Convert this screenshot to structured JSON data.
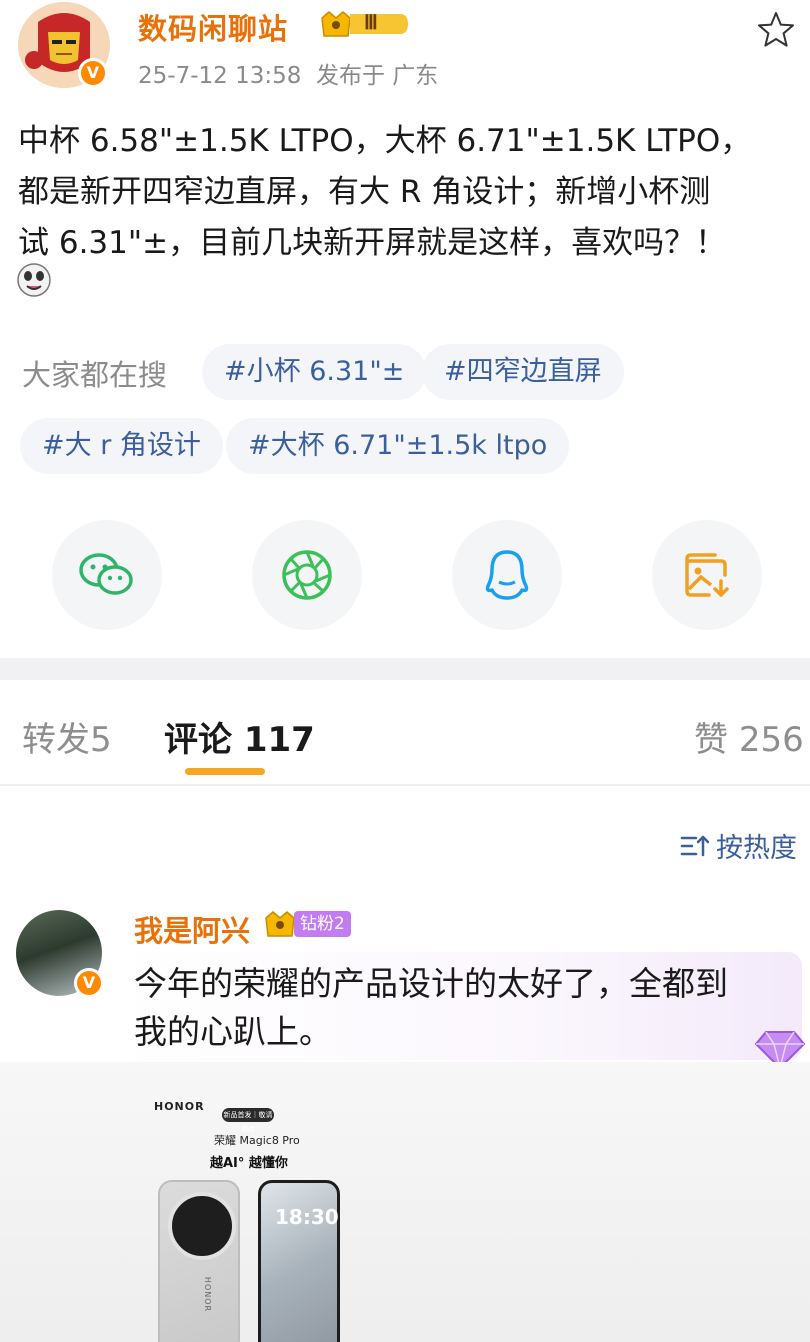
{
  "post": {
    "username": "数码闲聊站",
    "rank_badge": "Ⅲ",
    "timestamp": "25-7-12 13:58",
    "source": "发布于 广东",
    "text_lines": [
      "中杯 6.58\"±1.5K LTPO，大杯 6.71\"±1.5K LTPO，",
      "都是新开四窄边直屏，有大 R 角设计；新增小杯测",
      "试 6.31\"±，目前几块新开屏就是这样，喜欢吗？！"
    ]
  },
  "search": {
    "label": "大家都在搜",
    "chips": [
      "#小杯 6.31\"±",
      "#四窄边直屏",
      "#大 r 角设计",
      "#大杯 6.71\"±1.5k ltpo"
    ]
  },
  "share": {
    "icons": [
      "wechat-icon",
      "moments-icon",
      "qq-icon",
      "save-image-icon"
    ],
    "colors": {
      "wechat": "#2fb56a",
      "moments": "#3cc15a",
      "qq": "#1aa0f0",
      "save": "#f0a020"
    }
  },
  "tabs": [
    {
      "label": "转发",
      "count": "5"
    },
    {
      "label": "评论",
      "count": "117"
    },
    {
      "label": "赞",
      "count": "256"
    }
  ],
  "sort": {
    "label": "按热度"
  },
  "comment": {
    "username": "我是阿兴",
    "fan_badge": "钻粉2",
    "text_lines": [
      "今年的荣耀的产品设计的太好了，全都到",
      "我的心趴上。"
    ],
    "image": {
      "brand": "HONOR",
      "pill": "新品首发｜敬请期待",
      "model": "荣耀 Magic8 Pro",
      "slogan": "越AI° 越懂你",
      "clock": "18:30",
      "back_logo": "HONOR"
    }
  },
  "colors": {
    "accent": "#e8710a",
    "link": "#3a5f9c",
    "tab_indicator": "#f5a623"
  }
}
